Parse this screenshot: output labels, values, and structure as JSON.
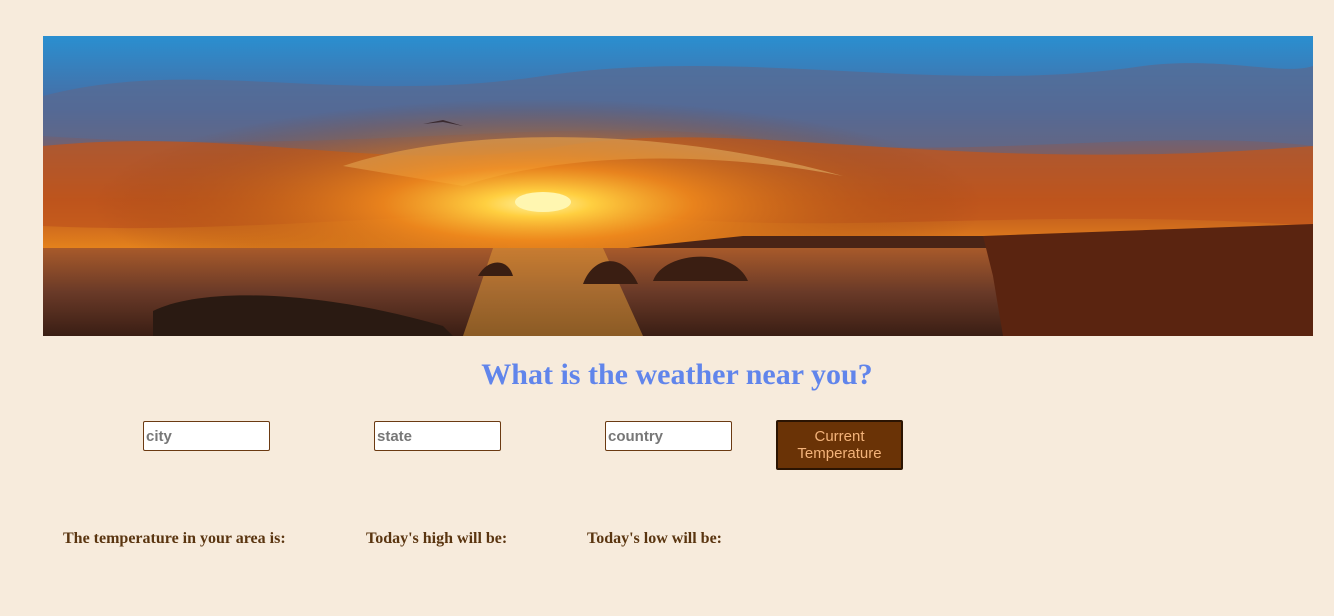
{
  "heading": "What is the weather near you?",
  "form": {
    "city_placeholder": "city",
    "state_placeholder": "state",
    "country_placeholder": "country",
    "button_label": "Current Temperature"
  },
  "results": {
    "temperature_label": "The temperature in your area is:",
    "high_label": "Today's high will be:",
    "low_label": "Today's low will be:"
  },
  "colors": {
    "background": "#f7ebdc",
    "heading": "#6185eb",
    "button_bg": "#6a3306",
    "button_text": "#f3b37a",
    "result_text": "#5a3510"
  }
}
